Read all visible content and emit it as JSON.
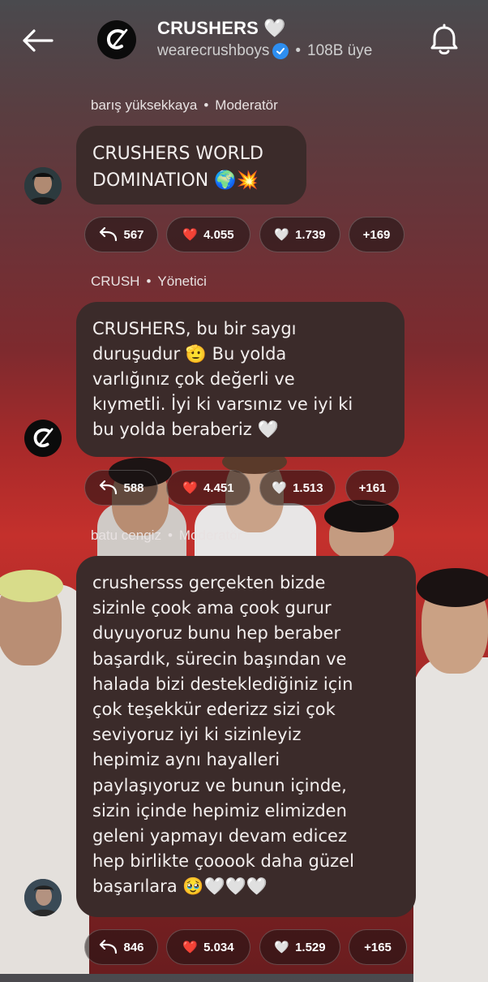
{
  "header": {
    "back_icon": "arrow-left-icon",
    "title": "CRUSHERS",
    "title_heart": "🤍",
    "handle": "wearecrushboys",
    "separator": "•",
    "members": "108B üye",
    "bell_icon": "bell-icon"
  },
  "messages": [
    {
      "author": "barış yüksekkaya",
      "role": "Moderatör",
      "text": "CRUSHERS WORLD\nDOMINATION 🌍💥",
      "reactions": {
        "reply": "567",
        "red_heart": "4.055",
        "white_heart": "1.739",
        "more": "+169"
      }
    },
    {
      "author": "CRUSH",
      "role": "Yönetici",
      "text": "CRUSHERS, bu bir saygı\nduruşudur 🫡 Bu yolda\nvarlığınız çok değerli ve\nkıymetli. İyi ki varsınız ve iyi ki\nbu yolda beraberiz 🤍",
      "reactions": {
        "reply": "588",
        "red_heart": "4.451",
        "white_heart": "1.513",
        "more": "+161"
      }
    },
    {
      "author": "batu cengiz",
      "role": "Moderatör",
      "text": "crushersss gerçekten bizde\nsizinle çook ama çook gurur\nduyuyoruz bunu hep beraber\nbaşardık, sürecin başından ve\nhalada bizi desteklediğiniz için\nçok teşekkür ederizz sizi çok\nseviyoruz iyi ki sizinleyiz\nhepimiz aynı hayalleri\npaylaşıyoruz ve bunun içinde,\nsizin içinde hepimiz elimizden\ngeleni yapmayı devam edicez\nhep birlikte çooook daha güzel\nbaşarılara 🥹🤍🤍🤍",
      "reactions": {
        "reply": "846",
        "red_heart": "5.034",
        "white_heart": "1.529",
        "more": "+165"
      }
    }
  ],
  "reaction_emojis": {
    "red_heart": "❤️",
    "white_heart": "🤍"
  },
  "colors": {
    "bubble": "#3b2b2a",
    "verified": "#2d8ef0",
    "red_heart": "#e0233c"
  }
}
